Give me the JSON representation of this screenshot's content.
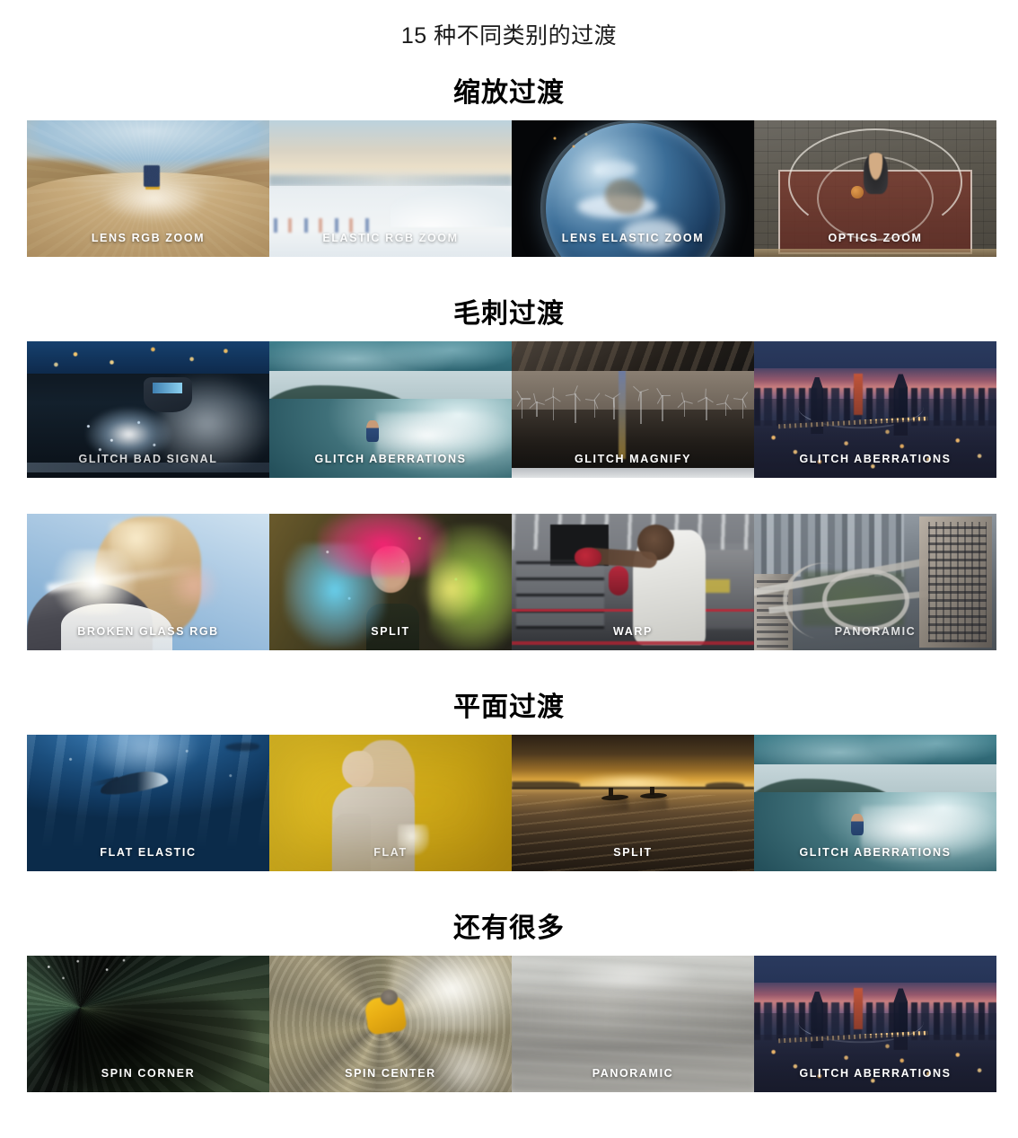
{
  "page": {
    "title": "15 种不同类别的过渡"
  },
  "sections": [
    {
      "heading": "缩放过渡",
      "items": [
        {
          "label": "LENS RGB ZOOM",
          "art": "lensrgb",
          "dim": false
        },
        {
          "label": "ELASTIC RGB ZOOM",
          "art": "elasticrgb",
          "dim": true
        },
        {
          "label": "LENS ELASTIC ZOOM",
          "art": "lenselastic",
          "dim": false
        },
        {
          "label": "OPTICS ZOOM",
          "art": "optics",
          "dim": false
        }
      ]
    },
    {
      "heading": "毛刺过渡",
      "items": [
        {
          "label": "GLITCH BAD SIGNAL",
          "art": "glitchbad",
          "dim": true
        },
        {
          "label": "GLITCH ABERRATIONS",
          "art": "surf",
          "dim": false
        },
        {
          "label": "GLITCH MAGNIFY",
          "art": "turbine",
          "dim": false
        },
        {
          "label": "GLITCH ABERRATIONS",
          "art": "bridge",
          "dim": false
        }
      ]
    },
    {
      "heading": "",
      "items": [
        {
          "label": "BROKEN GLASS RGB",
          "art": "broken",
          "dim": false
        },
        {
          "label": "SPLIT",
          "art": "holi",
          "dim": false
        },
        {
          "label": "WARP",
          "art": "warp",
          "dim": false
        },
        {
          "label": "PANORAMIC",
          "art": "pano",
          "dim": true
        }
      ]
    },
    {
      "heading": "平面过渡",
      "items": [
        {
          "label": "FLAT ELASTIC",
          "art": "flatel",
          "dim": false
        },
        {
          "label": "FLAT",
          "art": "flat",
          "dim": true
        },
        {
          "label": "SPLIT",
          "art": "kayak",
          "dim": false
        },
        {
          "label": "GLITCH ABERRATIONS",
          "art": "surf",
          "dim": false
        }
      ]
    },
    {
      "heading": "还有很多",
      "items": [
        {
          "label": "SPIN CORNER",
          "art": "spincorner",
          "dim": false
        },
        {
          "label": "SPIN CENTER",
          "art": "spincenter",
          "dim": false
        },
        {
          "label": "PANORAMIC",
          "art": "panoblur",
          "dim": false
        },
        {
          "label": "GLITCH ABERRATIONS",
          "art": "bridge",
          "dim": false
        }
      ]
    }
  ]
}
